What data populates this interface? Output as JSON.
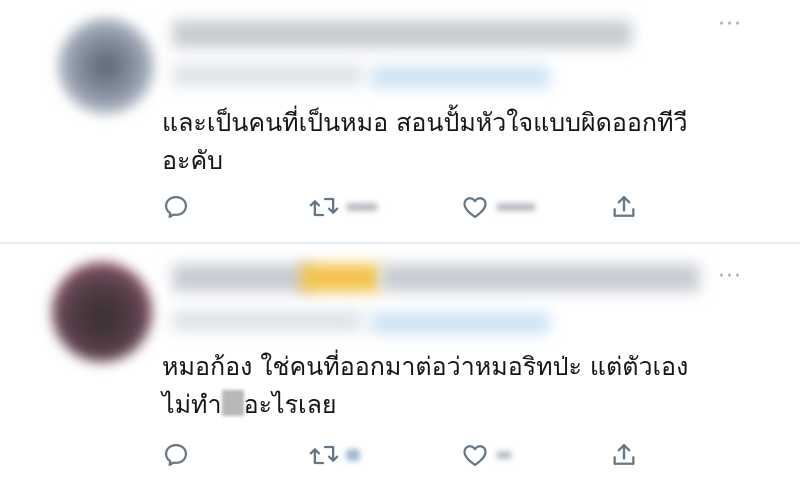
{
  "tweets": [
    {
      "text_line1": "และเป็นคนที่เป็นหมอ สอนปั้มหัวใจแบบผิดออกทีวี",
      "text_line2": "อะคับ",
      "more_icon": "more-options-icon",
      "actions": [
        "reply-icon",
        "retweet-icon",
        "like-icon",
        "share-icon"
      ]
    },
    {
      "text_line1": "หมอก้อง ใช่คนที่ออกมาต่อว่าหมอริทป่ะ แต่ตัวเอง",
      "text_line2_part1": "ไม่ทำ",
      "text_line2_part2": "อะไรเลย",
      "more_icon": "more-options-icon",
      "actions": [
        "reply-icon",
        "retweet-icon",
        "like-icon",
        "share-icon"
      ]
    }
  ],
  "more_glyph": "···",
  "colors": {
    "text": "#14171a",
    "icon": "#657786",
    "divider": "#e6ecf0"
  }
}
